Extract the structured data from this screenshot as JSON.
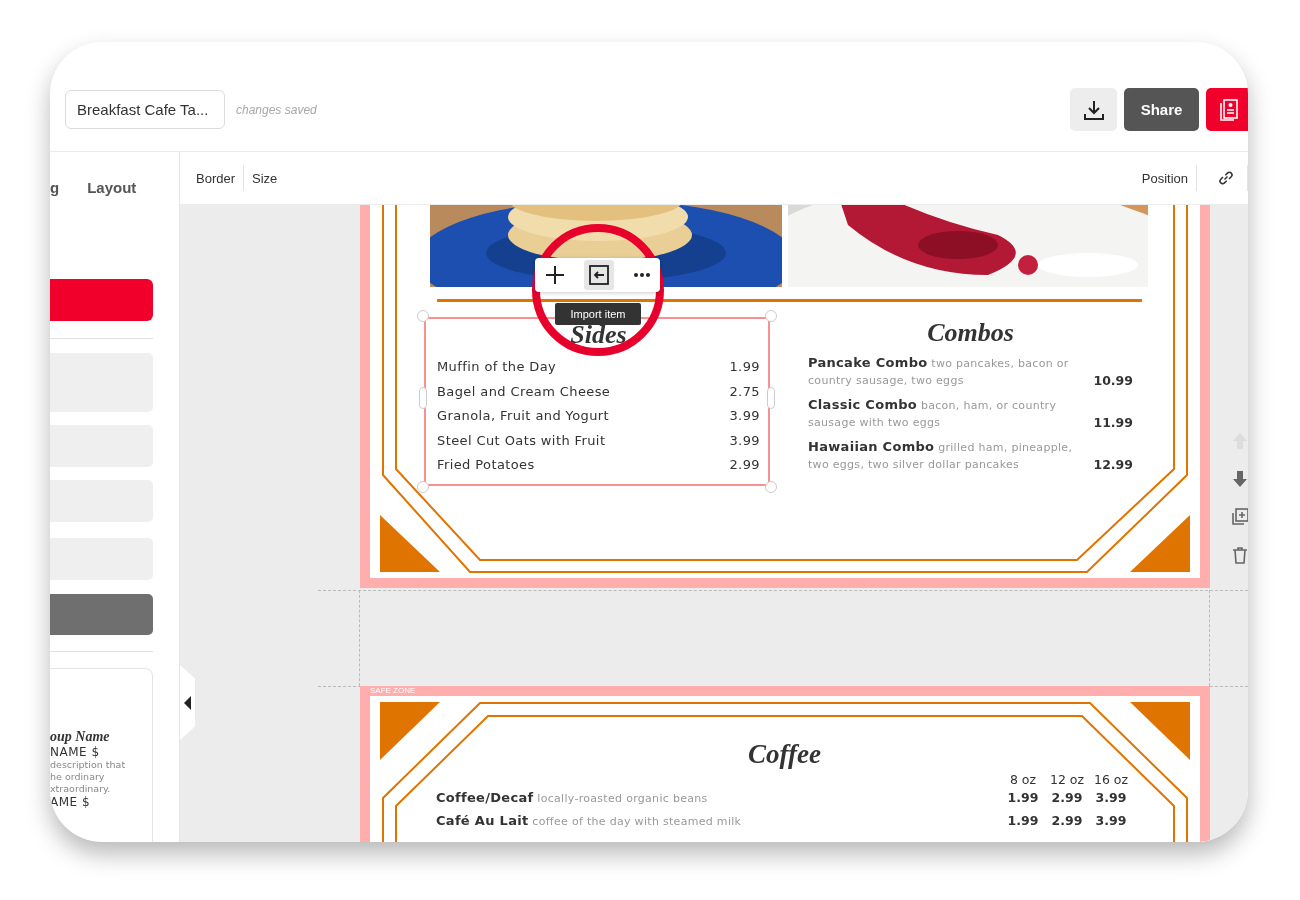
{
  "header": {
    "title": "Breakfast Cafe Ta...",
    "save_status": "changes saved",
    "share_button": "Share"
  },
  "sidebar": {
    "tabs": [
      "g",
      "Layout"
    ],
    "preview_card": {
      "group_name": "oup Name",
      "items": [
        {
          "name": "NAME $",
          "description": [
            "description that",
            "he ordinary",
            "xtraordinary."
          ]
        },
        {
          "name": "AME $"
        }
      ]
    }
  },
  "toolbar": {
    "left": [
      "Border",
      "Size"
    ],
    "right": [
      "Position"
    ]
  },
  "floating_toolbar": {
    "tooltip": "Import item"
  },
  "side_actions": [
    {
      "kind": "up",
      "disabled": true
    },
    {
      "kind": "down",
      "disabled": false
    },
    {
      "kind": "duplicate",
      "disabled": false
    },
    {
      "kind": "delete",
      "disabled": false
    }
  ],
  "page_1": {
    "sides": {
      "title": "Sides",
      "items": [
        {
          "name": "Muffin of the Day",
          "price": "1.99"
        },
        {
          "name": "Bagel and Cream Cheese",
          "price": "2.75"
        },
        {
          "name": "Granola, Fruit and Yogurt",
          "price": "3.99"
        },
        {
          "name": "Steel Cut Oats with Fruit",
          "price": "3.99"
        },
        {
          "name": "Fried Potatoes",
          "price": "2.99"
        }
      ]
    },
    "combos": {
      "title": "Combos",
      "items": [
        {
          "text": "**Pancake Combo** two pancakes, bacon or country sausage, two eggs",
          "price": "10.99"
        },
        {
          "text": "**Classic Combo** bacon, ham, or country sausage with two eggs",
          "price": "11.99"
        },
        {
          "text": "**Hawaiian Combo** grilled ham, pineapple, two eggs, two silver dollar pancakes",
          "price": "12.99"
        }
      ]
    }
  },
  "page_2": {
    "safe_zone_label": "SAFE ZONE",
    "title": "Coffee",
    "sizes": [
      "8 oz",
      "12 oz",
      "16 oz"
    ],
    "items": [
      {
        "text": "**Coffee/Decaf** locally-roasted organic beans",
        "prices": [
          "1.99",
          "2.99",
          "3.99"
        ]
      },
      {
        "text": "**Café Au Lait** coffee of the day with steamed milk",
        "prices": [
          "1.99",
          "2.99",
          "3.99"
        ]
      }
    ]
  }
}
